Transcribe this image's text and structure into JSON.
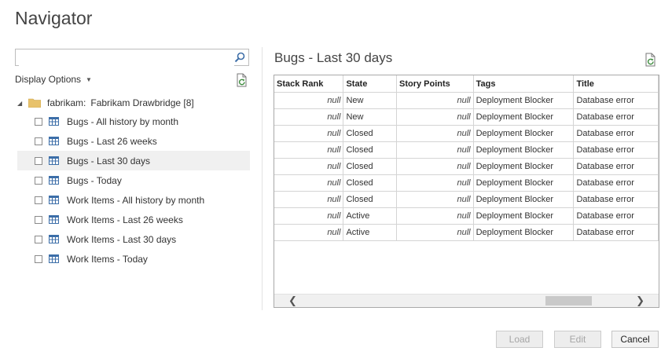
{
  "window": {
    "title": "Navigator"
  },
  "search": {
    "value": "",
    "placeholder": ""
  },
  "display_options": {
    "label": "Display Options"
  },
  "tree": {
    "root": {
      "name": "fabrikam:",
      "label": "Fabrikam Drawbridge [8]"
    },
    "items": [
      {
        "label": "Bugs - All history by month"
      },
      {
        "label": "Bugs - Last 26 weeks"
      },
      {
        "label": "Bugs - Last 30 days"
      },
      {
        "label": "Bugs - Today"
      },
      {
        "label": "Work Items - All history by month"
      },
      {
        "label": "Work Items - Last 26 weeks"
      },
      {
        "label": "Work Items - Last 30 days"
      },
      {
        "label": "Work Items - Today"
      }
    ]
  },
  "preview": {
    "title": "Bugs - Last 30 days",
    "columns": [
      "Stack Rank",
      "State",
      "Story Points",
      "Tags",
      "Title"
    ],
    "rows": [
      [
        "null",
        "New",
        "null",
        "Deployment Blocker",
        "Database error"
      ],
      [
        "null",
        "New",
        "null",
        "Deployment Blocker",
        "Database error"
      ],
      [
        "null",
        "Closed",
        "null",
        "Deployment Blocker",
        "Database error"
      ],
      [
        "null",
        "Closed",
        "null",
        "Deployment Blocker",
        "Database error"
      ],
      [
        "null",
        "Closed",
        "null",
        "Deployment Blocker",
        "Database error"
      ],
      [
        "null",
        "Closed",
        "null",
        "Deployment Blocker",
        "Database error"
      ],
      [
        "null",
        "Closed",
        "null",
        "Deployment Blocker",
        "Database error"
      ],
      [
        "null",
        "Active",
        "null",
        "Deployment Blocker",
        "Database error"
      ],
      [
        "null",
        "Active",
        "null",
        "Deployment Blocker",
        "Database error"
      ]
    ]
  },
  "scrollbar": {
    "left_arrow": "❮",
    "right_arrow": "❯"
  },
  "buttons": {
    "load": "Load",
    "edit": "Edit",
    "cancel": "Cancel"
  },
  "icons": {
    "search": "search-icon",
    "refresh": "refresh-icon",
    "folder": "folder-icon",
    "table": "table-icon",
    "expand": "expand-triangle-icon"
  },
  "colors": {
    "folder": "#e8c26b",
    "table_icon": "#3c6ea8",
    "selected_row": "#f0f0f0"
  }
}
